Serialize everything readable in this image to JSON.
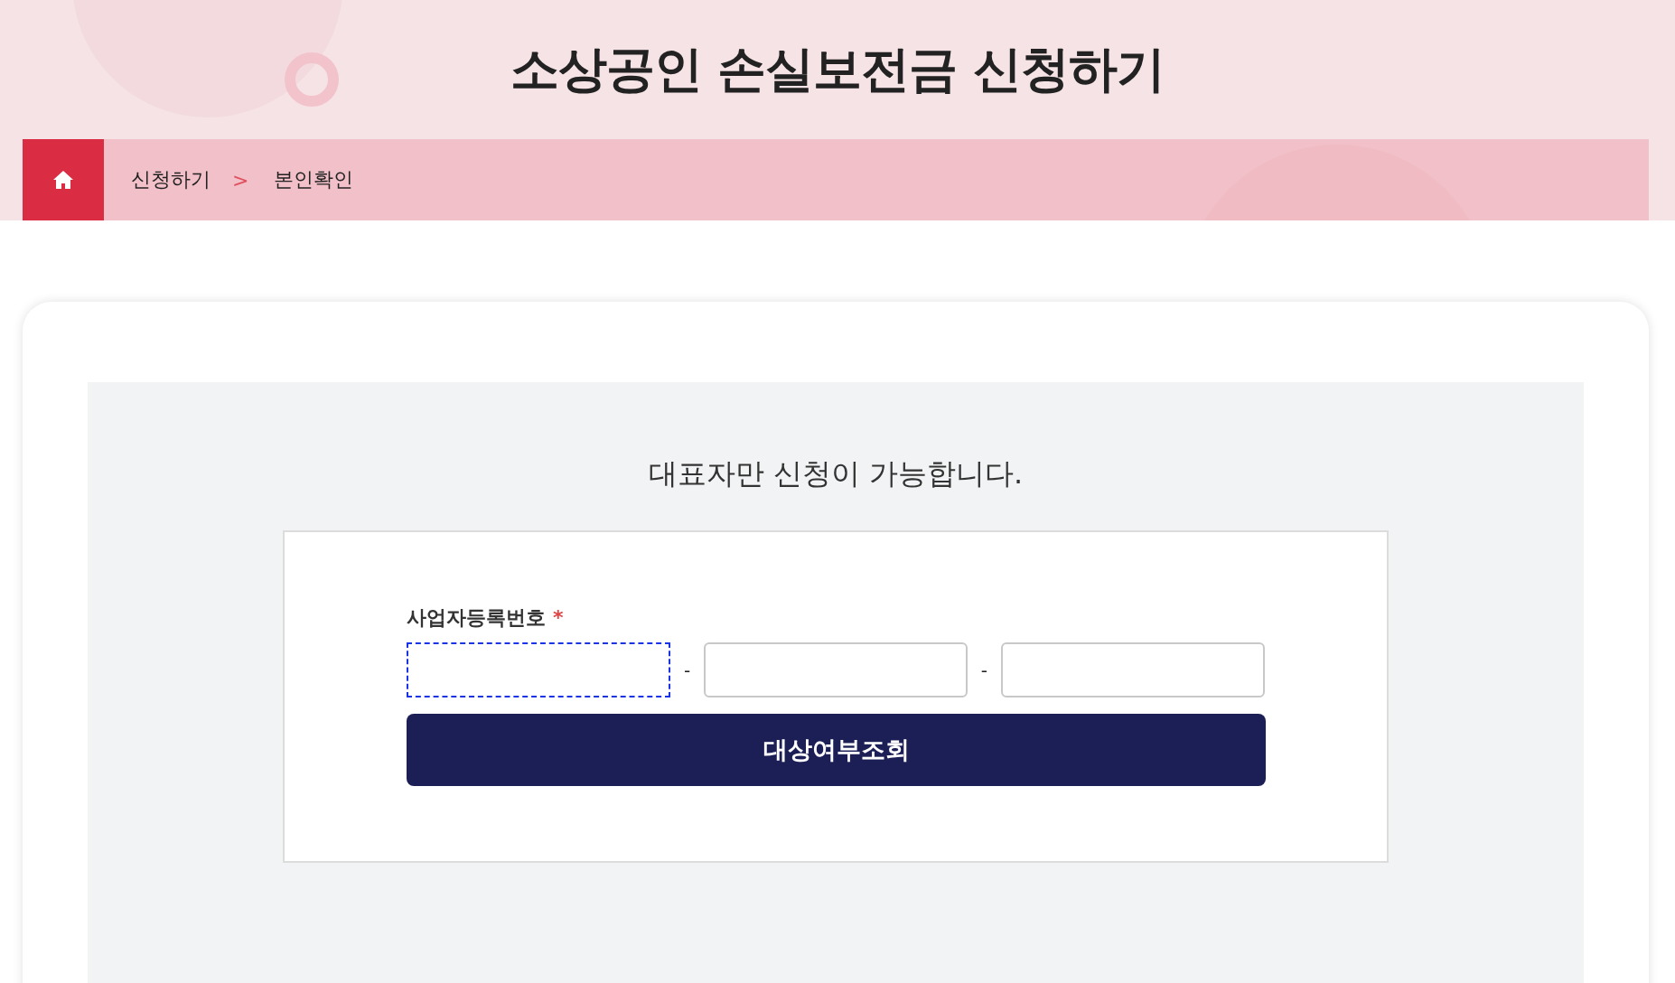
{
  "header": {
    "title": "소상공인 손실보전금 신청하기"
  },
  "breadcrumb": [
    {
      "label": "신청하기"
    },
    {
      "label": "본인확인"
    }
  ],
  "breadcrumb_separator": ">",
  "notice": "대표자만 신청이 가능합니다.",
  "form": {
    "label": "사업자등록번호",
    "required_mark": "*",
    "fields": [
      {
        "focused": true
      },
      {
        "focused": false
      },
      {
        "focused": false
      }
    ],
    "separators": [
      "-",
      "-"
    ],
    "button": "대상여부조회"
  }
}
